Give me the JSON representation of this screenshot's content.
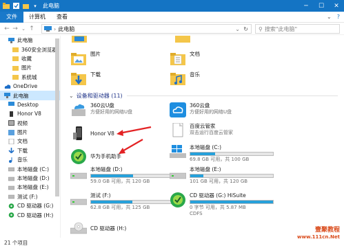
{
  "window": {
    "title": "此电脑"
  },
  "ribbon": {
    "tabs": [
      "文件",
      "计算机",
      "查看"
    ]
  },
  "address": {
    "path": "此电脑",
    "search_placeholder": "搜索\"此电脑\""
  },
  "sidebar": {
    "items": [
      {
        "label": "此电脑",
        "icon": "computer-icon"
      },
      {
        "label": "360安全浏览器",
        "icon": "folder-icon"
      },
      {
        "label": "收藏",
        "icon": "folder-icon"
      },
      {
        "label": "图片",
        "icon": "folder-icon"
      },
      {
        "label": "系统城",
        "icon": "folder-icon"
      },
      {
        "label": "OneDrive",
        "icon": "cloud-icon"
      },
      {
        "label": "此电脑",
        "icon": "computer-icon"
      },
      {
        "label": "Desktop",
        "icon": "desktop-icon"
      },
      {
        "label": "Honor V8",
        "icon": "phone-icon"
      },
      {
        "label": "视频",
        "icon": "video-icon"
      },
      {
        "label": "图片",
        "icon": "picture-icon"
      },
      {
        "label": "文档",
        "icon": "document-icon"
      },
      {
        "label": "下载",
        "icon": "download-icon"
      },
      {
        "label": "音乐",
        "icon": "music-icon"
      },
      {
        "label": "本地磁盘 (C:)",
        "icon": "drive-icon"
      },
      {
        "label": "本地磁盘 (D:)",
        "icon": "drive-icon"
      },
      {
        "label": "本地磁盘 (E:)",
        "icon": "drive-icon"
      },
      {
        "label": "测试 (F:)",
        "icon": "drive-icon"
      },
      {
        "label": "CD 驱动器 (G:)",
        "icon": "cd-icon"
      },
      {
        "label": "CD 驱动器 (H:)",
        "icon": "cd-icon"
      }
    ]
  },
  "folders": [
    {
      "label": "图片"
    },
    {
      "label": "文档"
    },
    {
      "label": "下载"
    },
    {
      "label": "音乐"
    }
  ],
  "devices_group": {
    "label": "设备和驱动器 (11)"
  },
  "devices": [
    {
      "name": "360云U盘",
      "sub": "方便好用的网络U盘",
      "icon": "usb-cloud-icon"
    },
    {
      "name": "360云盘",
      "sub": "方便好用的网络U盘",
      "icon": "cloud-drive-icon"
    },
    {
      "name": "Honor V8",
      "sub": "",
      "icon": "phone-icon"
    },
    {
      "name": "百度云管家",
      "sub": "双击运行百度云管家",
      "icon": "baidu-icon"
    },
    {
      "name": "华为手机助手",
      "sub": "",
      "icon": "huawei-icon"
    },
    {
      "name": "本地磁盘 (C:)",
      "sub": "69.8 GB 可用，共 100 GB",
      "icon": "windows-drive-icon",
      "used": 0.3
    },
    {
      "name": "本地磁盘 (D:)",
      "sub": "59.0 GB 可用，共 120 GB",
      "icon": "drive-icon",
      "used": 0.51
    },
    {
      "name": "本地磁盘 (E:)",
      "sub": "101 GB 可用，共 120 GB",
      "icon": "drive-icon",
      "used": 0.16
    },
    {
      "name": "测试 (F:)",
      "sub": "62.8 GB 可用，共 125 GB",
      "icon": "drive-icon",
      "used": 0.5
    },
    {
      "name": "CD 驱动器 (G:) HiSuite",
      "sub": "0 字节 可用，共 5.87 MB",
      "sub2": "CDFS",
      "icon": "hisuite-cd-icon",
      "used": 1.0
    },
    {
      "name": "CD 驱动器 (H:)",
      "sub": "",
      "icon": "cd-icon"
    }
  ],
  "status": {
    "count": "21 个项目"
  },
  "watermark": {
    "line1": "壹聚教程",
    "line2": "www.111cn.Net"
  },
  "colors": {
    "accent": "#1474c4",
    "bar": "#26a0da",
    "arrow": "#e32224"
  }
}
